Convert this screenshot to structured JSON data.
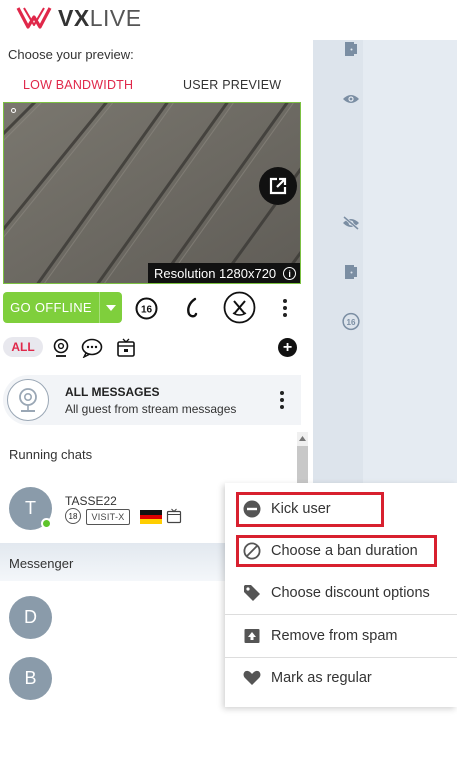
{
  "brand": {
    "logo_mark": "V",
    "name_bold": "VX",
    "name_light": "LIVE"
  },
  "preview": {
    "label": "Choose your preview:",
    "tabs": [
      {
        "label": "LOW BANDWIDTH",
        "active": true
      },
      {
        "label": "USER PREVIEW",
        "active": false
      }
    ],
    "resolution_text": "Resolution 1280x720",
    "popout_icon": "popout-icon"
  },
  "controls": {
    "go_offline_label": "GO OFFLINE",
    "fsk_badge": "16",
    "icons": [
      "age-16-icon",
      "handset-icon",
      "no-voice-icon",
      "more-icon"
    ]
  },
  "filters": {
    "all_label": "ALL",
    "icons": [
      "webcam-icon",
      "chat-bubble-icon",
      "tv-icon"
    ],
    "add_icon": "plus-circle-icon"
  },
  "all_messages": {
    "title": "ALL MESSAGES",
    "subtitle": "All guest from stream messages"
  },
  "running_chats": {
    "label": "Running chats",
    "items": [
      {
        "initial": "T",
        "name": "TASSE22",
        "age_badge": "18",
        "platform": "VISIT-X",
        "online": true
      }
    ]
  },
  "messenger": {
    "label": "Messenger",
    "items": [
      {
        "initial": "D"
      },
      {
        "initial": "B"
      }
    ]
  },
  "context_menu": {
    "items": [
      {
        "label": "Kick user",
        "icon": "minus-circle-icon",
        "highlighted": true
      },
      {
        "label": "Choose a ban duration",
        "icon": "ban-icon",
        "highlighted": true
      },
      {
        "label": "Choose discount options",
        "icon": "tag-icon",
        "highlighted": false
      },
      {
        "label": "Remove from spam",
        "icon": "inbox-up-icon",
        "highlighted": false
      },
      {
        "label": "Mark as regular",
        "icon": "heart-icon",
        "highlighted": false
      }
    ],
    "highlight_color": "#d8202f"
  },
  "right_pane": {
    "icons": [
      "door-exit-icon",
      "eye-icon",
      "eye-off-icon",
      "door-exit-icon",
      "age-16-icon"
    ],
    "fsk": "16"
  },
  "colors": {
    "accent": "#e0284a",
    "online_green": "#7fcf3c"
  }
}
